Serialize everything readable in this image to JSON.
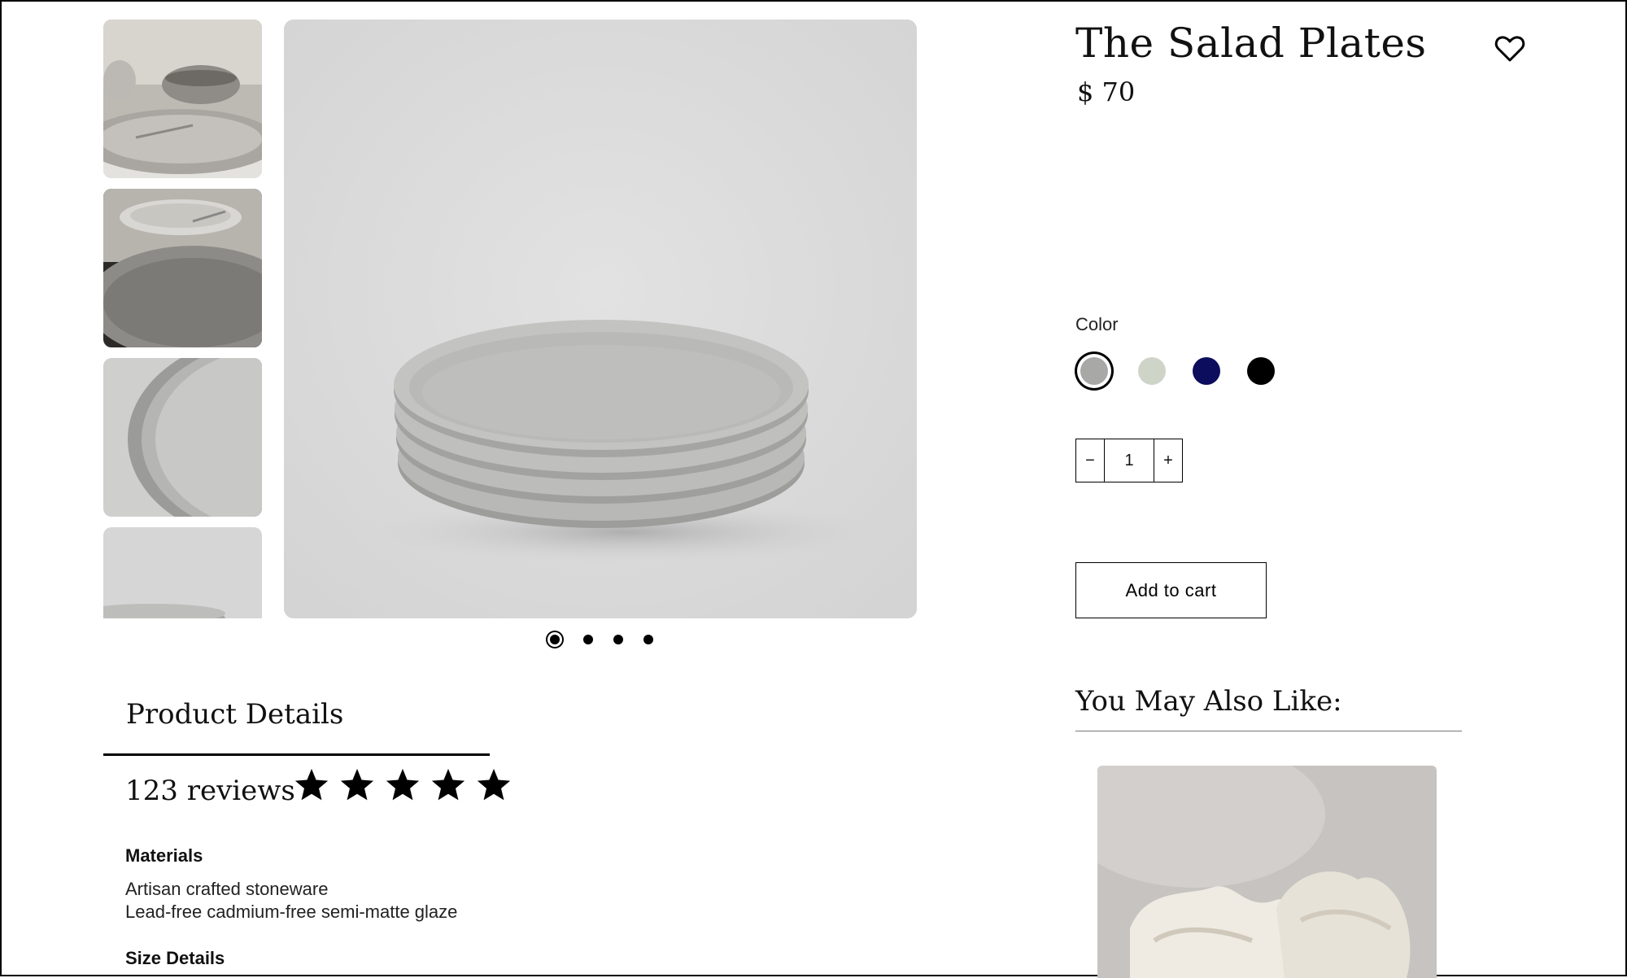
{
  "product": {
    "title": "The Salad Plates",
    "price": "$ 70",
    "favorite_icon": "heart-icon"
  },
  "gallery": {
    "thumbnails": [
      {
        "name": "table-setting-photo"
      },
      {
        "name": "plate-closeup-photo"
      },
      {
        "name": "plate-edge-photo"
      },
      {
        "name": "plate-stack-photo"
      }
    ],
    "main_image": "stacked-gray-plates-photo",
    "carousel": {
      "count": 4,
      "active_index": 0
    }
  },
  "options": {
    "color_label": "Color",
    "colors": [
      {
        "name": "gray",
        "hex": "#a8a8a6",
        "selected": true
      },
      {
        "name": "sage",
        "hex": "#cfd4c8",
        "selected": false
      },
      {
        "name": "navy",
        "hex": "#0d0d5e",
        "selected": false
      },
      {
        "name": "black",
        "hex": "#000000",
        "selected": false
      }
    ],
    "quantity": {
      "value": "1",
      "minus": "−",
      "plus": "+"
    }
  },
  "cart": {
    "add_label": "Add to cart"
  },
  "details": {
    "tab_label": "Product Details",
    "reviews": "123 reviews",
    "rating": 5,
    "rating_max": 5,
    "materials_heading": "Materials",
    "materials": [
      "Artisan crafted stoneware",
      "Lead-free cadmium-free semi-matte glaze"
    ],
    "size_heading": "Size Details"
  },
  "recommendations": {
    "heading": "You May Also Like:",
    "items": [
      {
        "name": "ceramic-bowls-photo"
      }
    ]
  }
}
